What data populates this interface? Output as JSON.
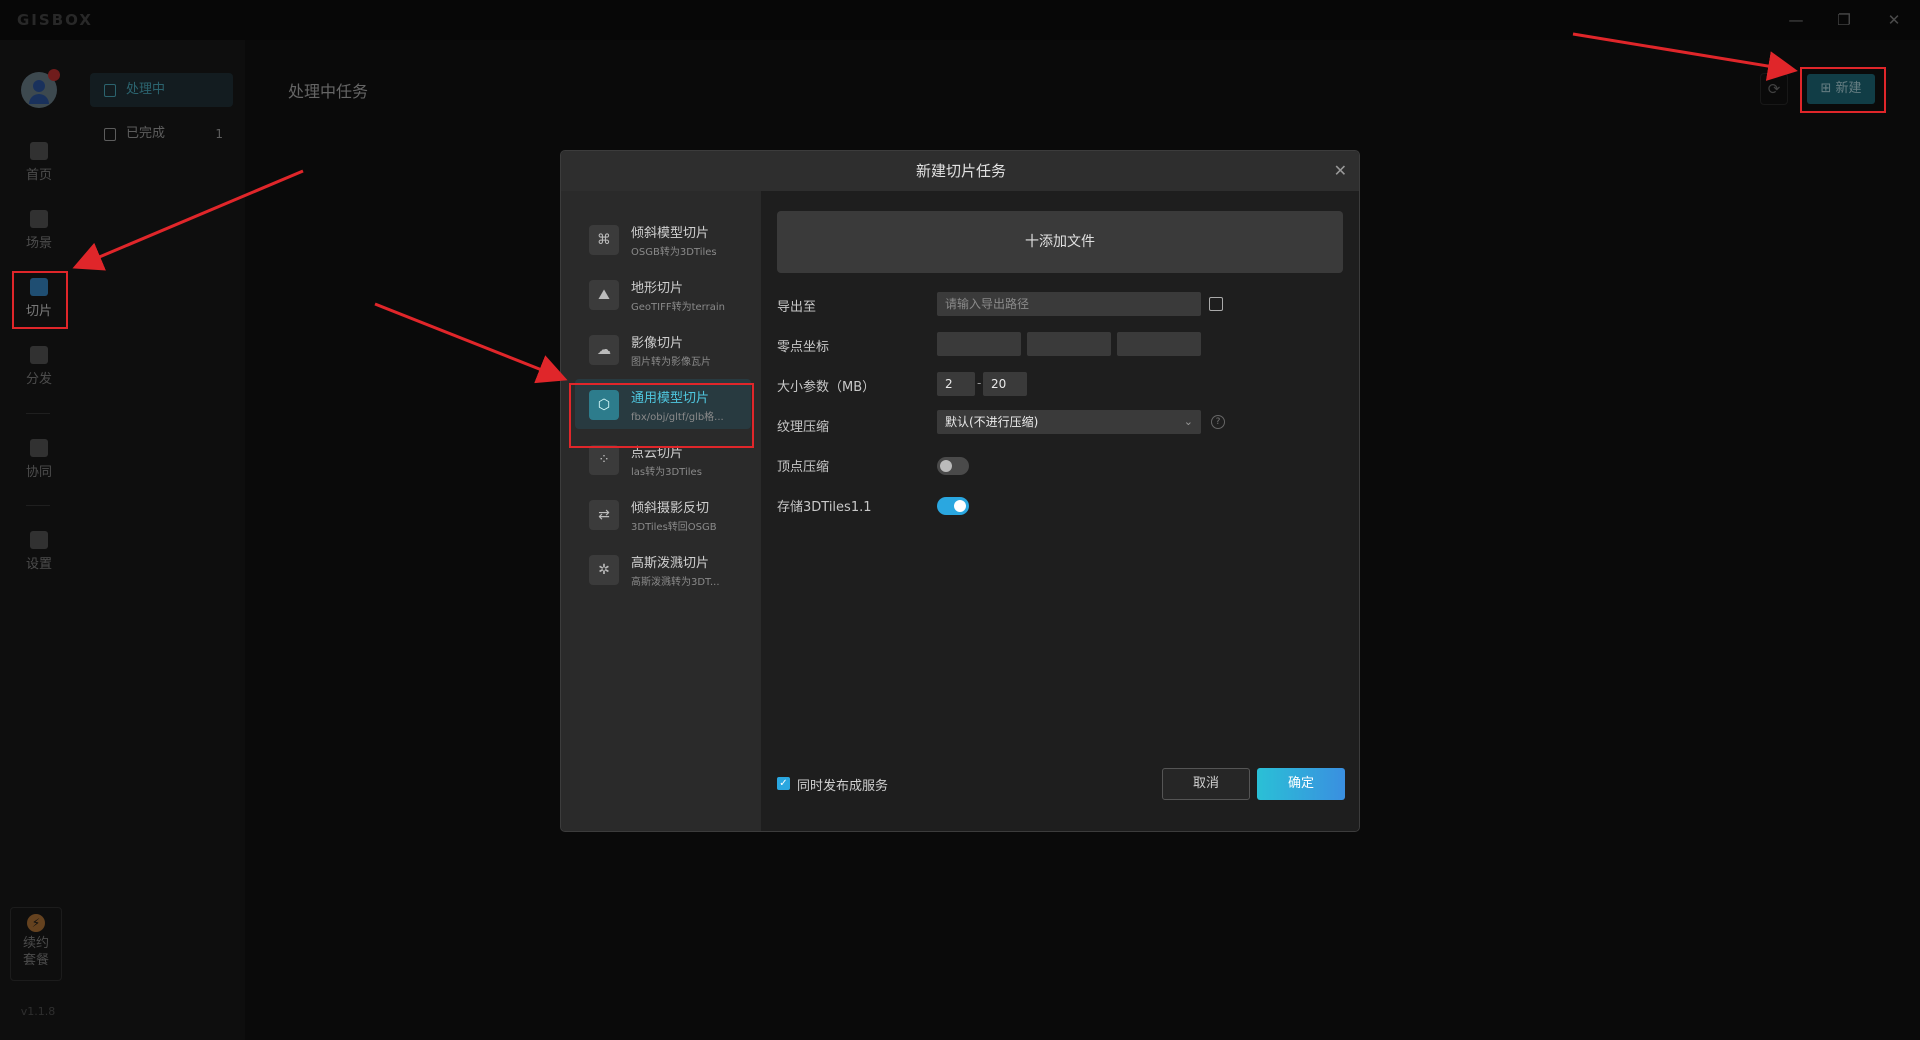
{
  "app": {
    "logo": "GISBOX",
    "version": "v1.1.8"
  },
  "window_controls": {
    "minimize": "—",
    "restore": "❐",
    "close": "✕"
  },
  "nav": {
    "items": [
      {
        "label": "首页",
        "icon": "home-icon"
      },
      {
        "label": "场景",
        "icon": "cube-icon"
      },
      {
        "label": "切片",
        "icon": "slice-icon",
        "active": true
      },
      {
        "label": "分发",
        "icon": "distribute-icon"
      },
      {
        "label": "协同",
        "icon": "lock-icon"
      },
      {
        "label": "设置",
        "icon": "gear-icon"
      }
    ],
    "renew": {
      "line1": "续约",
      "line2": "套餐",
      "icon": "bolt-icon"
    }
  },
  "task_sidebar": {
    "items": [
      {
        "label": "处理中",
        "active": true
      },
      {
        "label": "已完成",
        "count": "1"
      }
    ]
  },
  "main": {
    "title": "处理中任务",
    "refresh_icon": "⟳",
    "new_button": "新建"
  },
  "dialog": {
    "title": "新建切片任务",
    "close": "✕",
    "types": [
      {
        "name": "倾斜模型切片",
        "desc": "OSGB转为3DTiles",
        "icon": "⌘"
      },
      {
        "name": "地形切片",
        "desc": "GeoTIFF转为terrain",
        "icon": "⛰"
      },
      {
        "name": "影像切片",
        "desc": "图片转为影像瓦片",
        "icon": "☁"
      },
      {
        "name": "通用模型切片",
        "desc": "fbx/obj/gltf/glb格...",
        "icon": "⬡",
        "active": true
      },
      {
        "name": "点云切片",
        "desc": "las转为3DTiles",
        "icon": "⁘"
      },
      {
        "name": "倾斜摄影反切",
        "desc": "3DTiles转回OSGB",
        "icon": "⇄"
      },
      {
        "name": "高斯泼溅切片",
        "desc": "高斯泼溅转为3DT...",
        "icon": "✲"
      }
    ],
    "add_file": "十添加文件",
    "form": {
      "export_label": "导出至",
      "export_placeholder": "请输入导出路径",
      "origin_label": "零点坐标",
      "origin_values": [
        "",
        "",
        ""
      ],
      "size_label": "大小参数（MB）",
      "size_min": "2",
      "size_dash": "-",
      "size_max": "20",
      "texture_label": "纹理压缩",
      "texture_value": "默认(不进行压缩)",
      "help": "?",
      "vertex_label": "顶点压缩",
      "vertex_on": false,
      "tiles11_label": "存储3DTiles1.1",
      "tiles11_on": true
    },
    "publish_label": "同时发布成服务",
    "publish_checked": true,
    "cancel": "取消",
    "ok": "确定"
  },
  "colors": {
    "accent": "#2aa7e0",
    "annotation": "#e0262a",
    "active_text": "#4fc7df"
  }
}
